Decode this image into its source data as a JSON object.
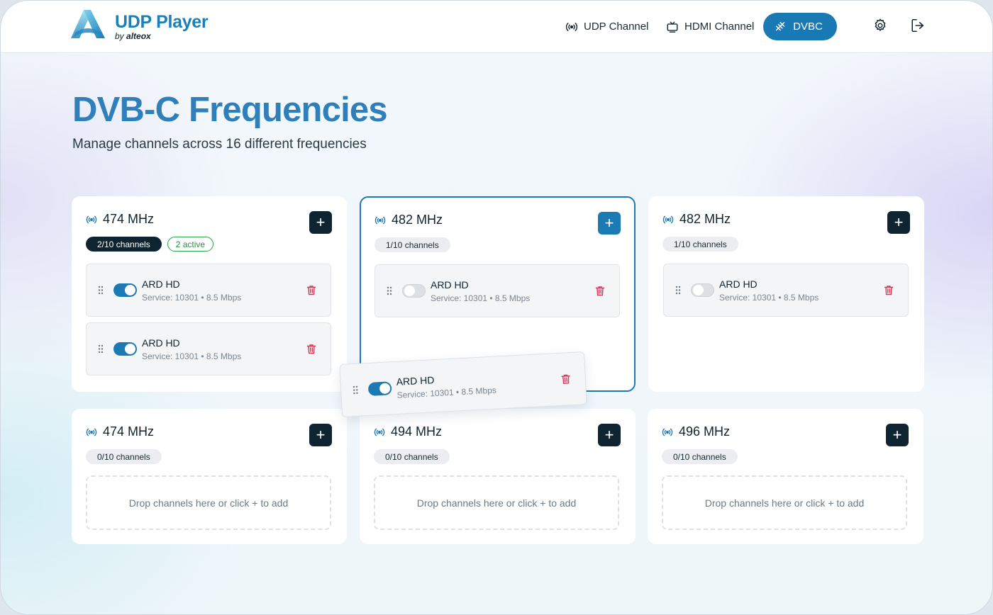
{
  "app": {
    "title": "UDP Player",
    "subtitle_prefix": "by",
    "subtitle_brand": "alteox",
    "brand_color": "#1d7fb6"
  },
  "nav": {
    "udp": "UDP Channel",
    "hdmi": "HDMI Channel",
    "dvbc": "DVBC",
    "active": "DVBC",
    "icons": [
      "broadcast-icon",
      "tv-icon",
      "antenna-icon",
      "gear-icon",
      "logout-icon"
    ]
  },
  "page": {
    "title": "DVB-C Frequencies",
    "subtitle": "Manage channels across 16 different frequencies"
  },
  "cards": [
    {
      "frequency": "474 MHz",
      "count": "2/10 channels",
      "active": "2 active",
      "highlighted": false,
      "channels": [
        {
          "name": "ARD HD",
          "meta": "Service: 10301 • 8.5 Mbps",
          "enabled": true
        },
        {
          "name": "ARD HD",
          "meta": "Service: 10301 • 8.5 Mbps",
          "enabled": true
        }
      ]
    },
    {
      "frequency": "482 MHz",
      "count": "1/10 channels",
      "highlighted": true,
      "channels": [
        {
          "name": "ARD HD",
          "meta": "Service: 10301 • 8.5 Mbps",
          "enabled": false
        }
      ]
    },
    {
      "frequency": "482 MHz",
      "count": "1/10 channels",
      "highlighted": false,
      "channels": [
        {
          "name": "ARD HD",
          "meta": "Service: 10301 • 8.5 Mbps",
          "enabled": false
        }
      ]
    },
    {
      "frequency": "474 MHz",
      "count": "0/10 channels",
      "dropzone": "Drop channels here or click + to add"
    },
    {
      "frequency": "494 MHz",
      "count": "0/10 channels",
      "dropzone": "Drop channels here or click + to add"
    },
    {
      "frequency": "496 MHz",
      "count": "0/10 channels",
      "dropzone": "Drop channels here or click + to add"
    }
  ],
  "dragging": {
    "name": "ARD HD",
    "meta": "Service: 10301 • 8.5 Mbps",
    "enabled": true
  },
  "add_label": "+",
  "colors": {
    "accent": "#1b7ab4",
    "dark": "#0e2430",
    "active_green": "#29a548",
    "delete_red": "#d8365a"
  }
}
